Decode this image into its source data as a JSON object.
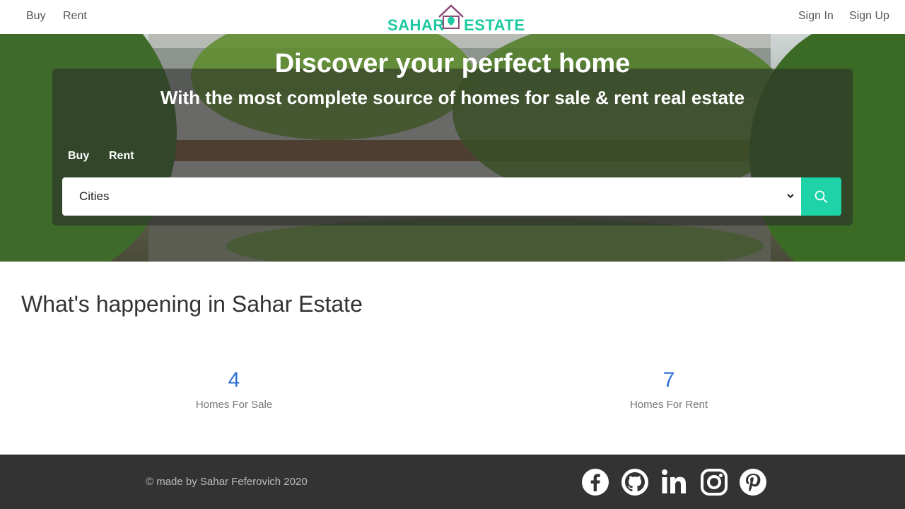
{
  "header": {
    "nav": [
      "Buy",
      "Rent"
    ],
    "logo": {
      "left_word": "SAHAR",
      "right_word": "ESTATE"
    },
    "auth": [
      "Sign In",
      "Sign Up"
    ]
  },
  "hero": {
    "title": "Discover your perfect home",
    "subtitle": "With the most complete source of homes for sale & rent real estate",
    "tabs": [
      "Buy",
      "Rent"
    ],
    "search_select_value": "Cities"
  },
  "stats": {
    "title": "What's happening in Sahar Estate",
    "items": [
      {
        "number": "4",
        "label": "Homes For Sale"
      },
      {
        "number": "7",
        "label": "Homes For Rent"
      }
    ]
  },
  "footer": {
    "copyright": "© made by Sahar Feferovich 2020",
    "socials": [
      "facebook-icon",
      "github-icon",
      "linkedin-icon",
      "instagram-icon",
      "pinterest-icon"
    ]
  },
  "colors": {
    "accent": "#1dd3a7",
    "number_blue": "#2f6fd3",
    "footer_bg": "#333333"
  }
}
